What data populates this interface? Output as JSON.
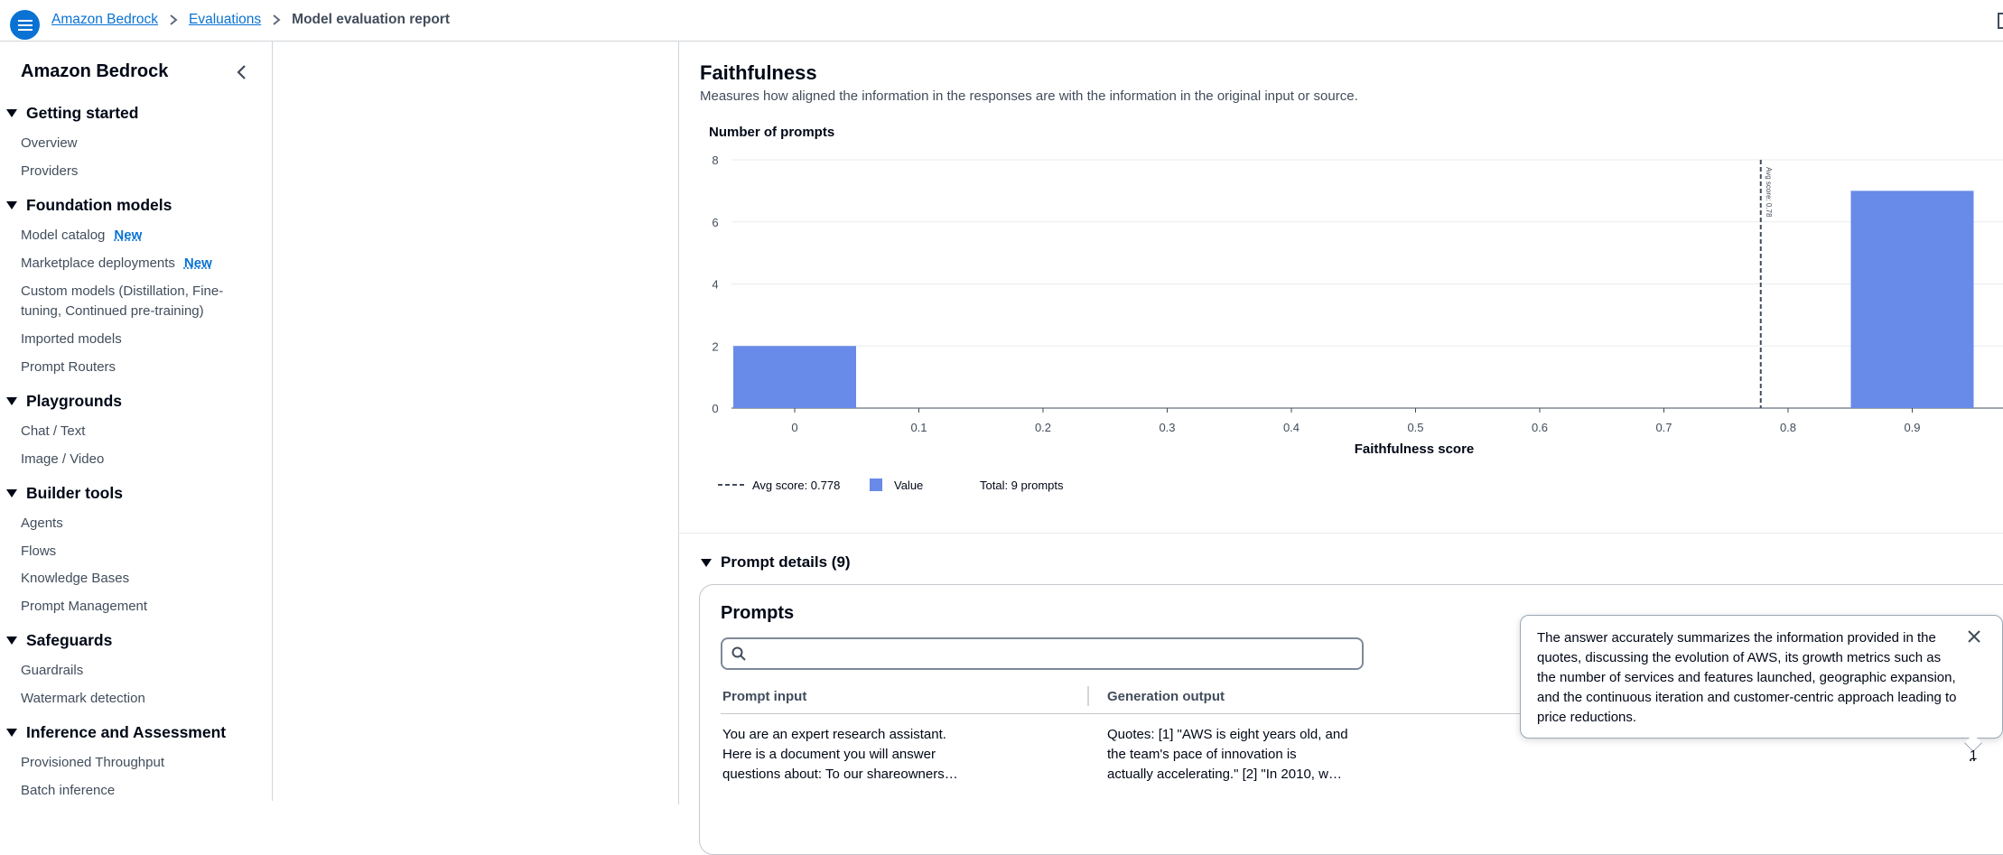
{
  "topbar": {
    "breadcrumbs": [
      "Amazon Bedrock",
      "Evaluations",
      "Model evaluation report"
    ]
  },
  "sidebar": {
    "title": "Amazon Bedrock",
    "sections": [
      {
        "label": "Getting started",
        "items": [
          "Overview",
          "Providers"
        ]
      },
      {
        "label": "Foundation models",
        "items": [
          "Model catalog",
          "Marketplace deployments",
          "Custom models (Distillation, Fine-",
          "tuning, Continued pre-training)",
          "Imported models",
          "Prompt Routers"
        ]
      },
      {
        "label": "Playgrounds",
        "items": [
          "Chat / Text",
          "Image / Video"
        ]
      },
      {
        "label": "Builder tools",
        "items": [
          "Agents",
          "Flows",
          "Knowledge Bases",
          "Prompt Management"
        ]
      },
      {
        "label": "Safeguards",
        "items": [
          "Guardrails",
          "Watermark detection"
        ]
      },
      {
        "label": "Inference and Assessment",
        "items": [
          "Provisioned Throughput",
          "Batch inference"
        ]
      }
    ],
    "new_badge": "New"
  },
  "metric": {
    "title": "Faithfulness",
    "description": "Measures how aligned the information in the responses are with the information in the original input or source."
  },
  "chart_data": {
    "type": "bar",
    "title": "",
    "ylabel": "Number of prompts",
    "xlabel": "Faithfulness score",
    "categories": [
      "0",
      "0.1",
      "0.2",
      "0.3",
      "0.4",
      "0.5",
      "0.6",
      "0.7",
      "0.8",
      "0.9"
    ],
    "values": [
      2,
      0,
      0,
      0,
      0,
      0,
      0,
      0,
      0,
      7
    ],
    "ylim": [
      0,
      8
    ],
    "yticks": [
      "0",
      "2",
      "4",
      "6",
      "8"
    ],
    "avg_score": 0.778,
    "avg_marker_label": "Avg score: 0.78",
    "legend": {
      "avg": "Avg score: 0.778",
      "value": "Value",
      "total": "Total: 9 prompts"
    },
    "bar_color": "#688ae8",
    "grid": true,
    "legend_position": "bottom-left"
  },
  "prompt_details": {
    "toggle_label": "Prompt details (9)",
    "card_title": "Prompts",
    "search_placeholder": "",
    "columns": [
      "Prompt input",
      "Generation output"
    ],
    "rows": [
      {
        "prompt_input": [
          "You are an expert research assistant.",
          "Here is a document you will answer",
          "questions about: To our shareowners…"
        ],
        "generation_output": [
          "Quotes: [1] \"AWS is eight years old, and",
          "the team's pace of innovation is",
          "actually accelerating.\" [2] \"In 2010, w…"
        ],
        "score": "1"
      }
    ]
  },
  "popover": {
    "text": "The answer accurately summarizes the information provided in the quotes, discussing the evolution of AWS, its growth metrics such as the number of services and features launched, geographic expansion, and the continuous iteration and customer-centric approach leading to price reductions."
  },
  "colors": {
    "accent": "#0972d3",
    "bar": "#688ae8"
  }
}
